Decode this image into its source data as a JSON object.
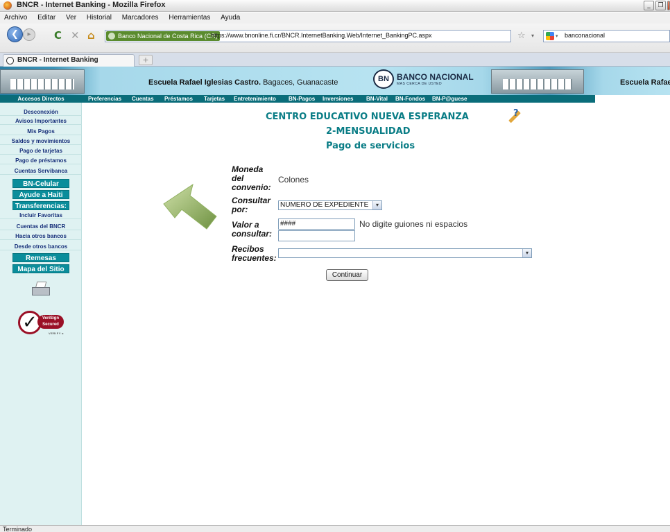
{
  "window": {
    "title": "BNCR - Internet Banking - Mozilla Firefox",
    "controls": [
      "_",
      "❐",
      "×"
    ]
  },
  "menu": [
    "Archivo",
    "Editar",
    "Ver",
    "Historial",
    "Marcadores",
    "Herramientas",
    "Ayuda"
  ],
  "toolbar": {
    "back_glyph": "❮",
    "forward_glyph": "▸",
    "reload_glyph": "C",
    "stop_glyph": "✕",
    "home_glyph": "⌂",
    "site_identity": "Banco Nacional de Costa Rica (CR)",
    "url": "https://www.bnonline.fi.cr/BNCR.InternetBanking.Web/Internet_BankingPC.aspx",
    "star_glyph": "☆",
    "dropdown_glyph": "▾",
    "search_engine_drop": "▾",
    "search_text": "banconacional"
  },
  "tabs": {
    "active": "BNCR - Internet Banking",
    "new_tab_glyph": "+"
  },
  "banner": {
    "school_bold": "Escuela Rafael Iglesias Castro.",
    "school_rest": " Bagaces, Guanacaste",
    "logo_mark": "BN",
    "logo_name": "BANCO NACIONAL",
    "logo_tagline": "MAS CERCA DE USTED",
    "school_bold_2": "Escuela Rafae"
  },
  "nav": {
    "accesos": "Accesos Directos",
    "items": [
      "Preferencias",
      "Cuentas",
      "Préstamos",
      "Tarjetas",
      "Entretenimiento",
      "BN-Pagos",
      "Inversiones",
      "BN-Vital",
      "BN-Fondos",
      "BN-P@guese"
    ]
  },
  "sidebar": {
    "items_top": [
      "Desconexión",
      "Avisos Importantes",
      "Mis Pagos",
      "Saldos y movimientos",
      "Pago de tarjetas",
      "Pago de préstamos",
      "Cuentas Servibanca"
    ],
    "btn_celular": "BN-Celular",
    "btn_haiti": "Ayude a Haiti",
    "btn_transferencias": "Transferencias:",
    "items_transfer": [
      "Incluir Favoritas",
      "Cuentas del BNCR",
      "Hacia otros bancos",
      "Desde otros bancos"
    ],
    "btn_remesas": "Remesas",
    "btn_mapa": "Mapa del Sitio",
    "verisign_line1": "VeriSign",
    "verisign_line2": "Secured",
    "verisign_verify": "VERIFY ▸",
    "verisign_check": "✓"
  },
  "content": {
    "title": "CENTRO EDUCATIVO NUEVA ESPERANZA",
    "subtitle": "2-MENSUALIDAD",
    "section": "Pago de servicios",
    "help_glyph": "?",
    "moneda_label": [
      "Moneda",
      "del",
      "convenio:"
    ],
    "moneda_value": "Colones",
    "consultar_label": [
      "Consultar",
      "por:"
    ],
    "consultar_value": "NUMERO DE EXPEDIENTE",
    "valor_label": [
      "Valor a",
      "consultar:"
    ],
    "valor_value": "####",
    "valor_hint": "No digite guiones ni espacios",
    "recibos_label": [
      "Recibos",
      "frecuentes:"
    ],
    "recibos_value": "",
    "select_arrow": "▾",
    "continuar_label": "Continuar"
  },
  "status": {
    "text": "Terminado"
  }
}
